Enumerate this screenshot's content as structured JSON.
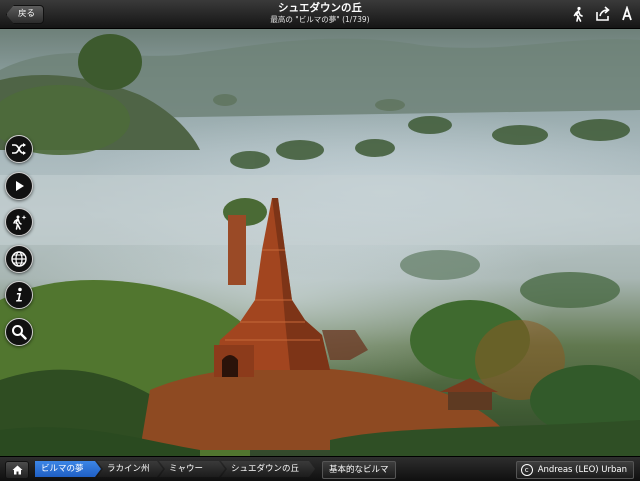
{
  "header": {
    "back_label": "戻る",
    "title": "シュエダウンの丘",
    "subtitle": "最高の \"ビルマの夢\" (1/739)",
    "icons": [
      "walk-icon",
      "share-icon",
      "font-size-icon"
    ]
  },
  "side_buttons": [
    "shuffle-icon",
    "play-icon",
    "sparkle-person-icon",
    "globe-icon",
    "info-icon",
    "search-icon"
  ],
  "breadcrumb": {
    "items": [
      "ビルマの夢",
      "ラカイン州",
      "ミャウー",
      "シュエダウンの丘"
    ],
    "active_index": 0
  },
  "basic_button_label": "基本的なビルマ",
  "credit": {
    "symbol": "c",
    "text": "Andreas (LEO) Urban"
  },
  "colors": {
    "bar_dark": "#151515",
    "breadcrumb_active": "#2f74d8",
    "text": "#ffffff"
  }
}
